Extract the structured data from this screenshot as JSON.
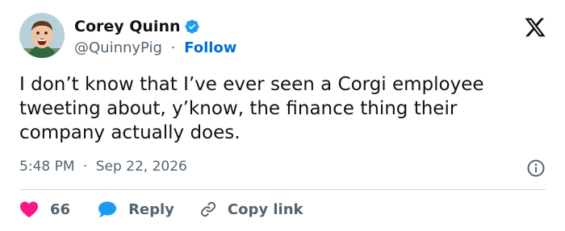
{
  "author": {
    "name": "Corey Quinn",
    "handle": "@QuinnyPig",
    "separator": "·",
    "follow_label": "Follow"
  },
  "tweet": {
    "lines": [
      "I don’t know that I’ve ever seen a Corgi employee",
      "tweeting about, y’know, the finance thing their",
      "company actually does."
    ]
  },
  "meta": {
    "time": "5:48 PM",
    "separator": "·",
    "date": "Sep 22, 2026"
  },
  "actions": {
    "like_count": "66",
    "reply_label": "Reply",
    "copy_label": "Copy link"
  },
  "colors": {
    "verified": "#1d9bf0",
    "like": "#f91880",
    "reply": "#1d9bf0",
    "follow": "#006fd6",
    "muted": "#536471"
  },
  "icons": {
    "verified": "verified-badge-icon",
    "brand": "x-logo-icon",
    "info": "info-icon",
    "like": "heart-icon",
    "reply": "speech-bubble-icon",
    "copy": "link-icon"
  }
}
